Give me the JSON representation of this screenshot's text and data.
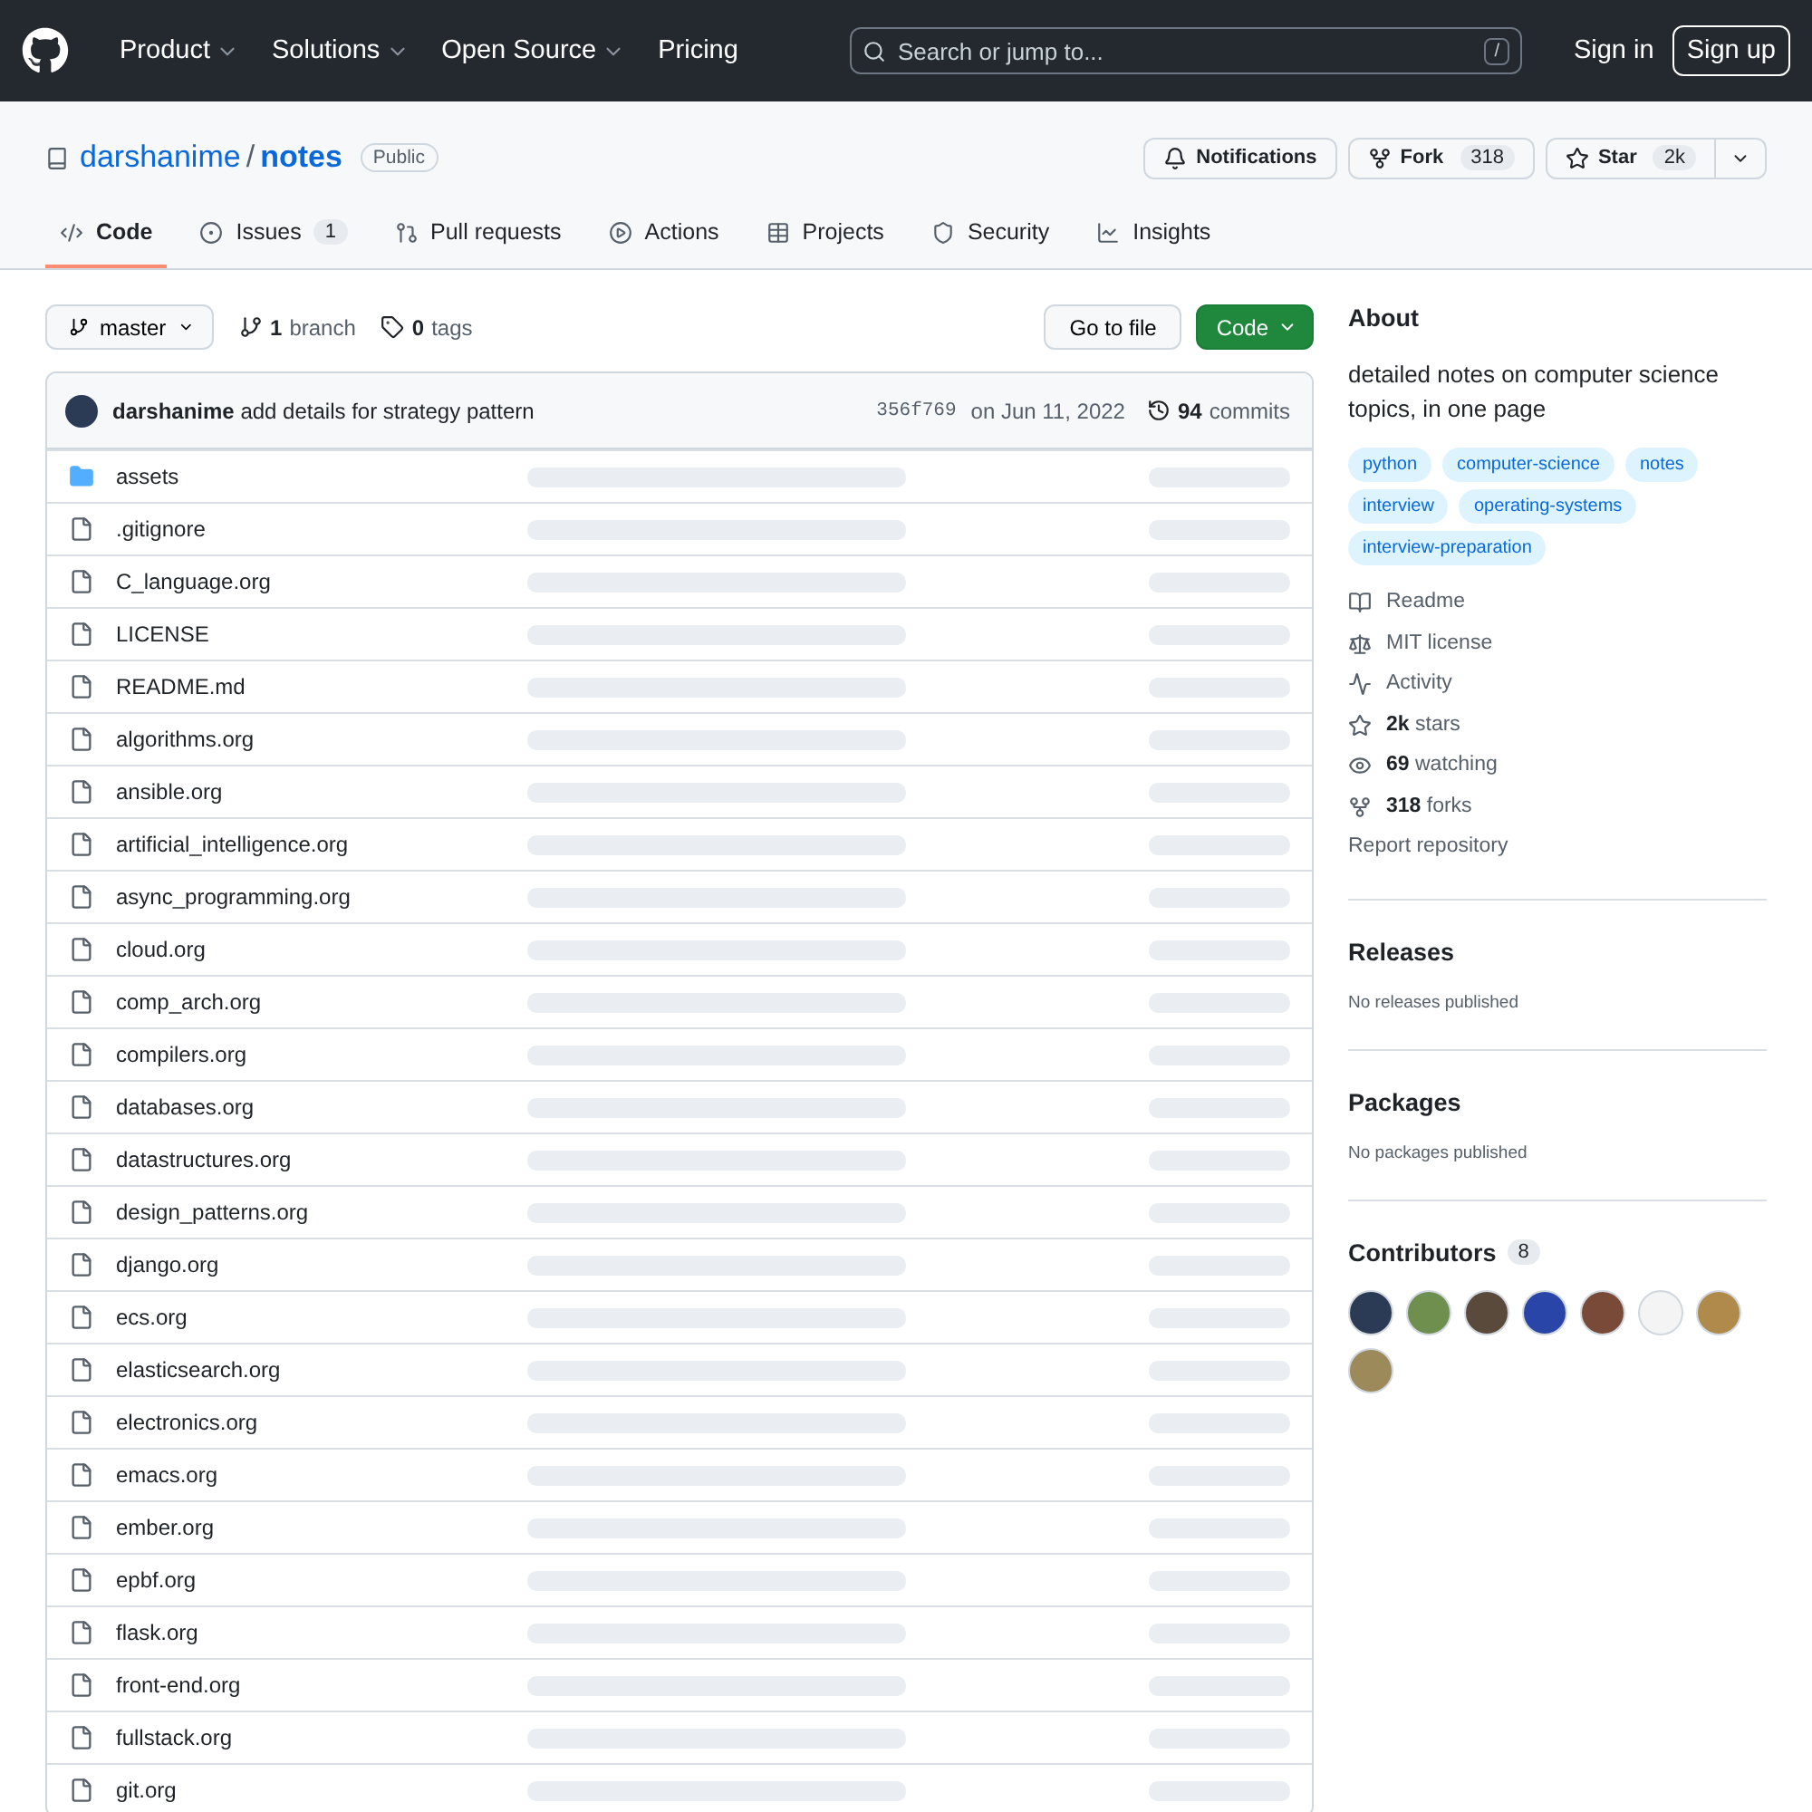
{
  "nav": {
    "items": [
      {
        "label": "Product",
        "dropdown": true
      },
      {
        "label": "Solutions",
        "dropdown": true
      },
      {
        "label": "Open Source",
        "dropdown": true
      },
      {
        "label": "Pricing",
        "dropdown": false
      }
    ],
    "search": {
      "placeholder": "Search or jump to...",
      "shortcut": "/"
    },
    "sign_in": "Sign in",
    "sign_up": "Sign up"
  },
  "repo": {
    "owner": "darshanime",
    "separator": "/",
    "name": "notes",
    "visibility": "Public",
    "actions": [
      {
        "kind": "notifications",
        "label": "Notifications"
      },
      {
        "kind": "fork",
        "label": "Fork",
        "count": "318"
      },
      {
        "kind": "star",
        "label": "Star",
        "count": "2k"
      }
    ]
  },
  "tabs": [
    {
      "kind": "code",
      "label": "Code",
      "selected": true
    },
    {
      "kind": "issues",
      "label": "Issues",
      "count": "1",
      "selected": false
    },
    {
      "kind": "pulls",
      "label": "Pull requests",
      "selected": false
    },
    {
      "kind": "actions",
      "label": "Actions",
      "selected": false
    },
    {
      "kind": "projects",
      "label": "Projects",
      "selected": false
    },
    {
      "kind": "security",
      "label": "Security",
      "selected": false
    },
    {
      "kind": "insights",
      "label": "Insights",
      "selected": false
    }
  ],
  "toolbar": {
    "branch": "master",
    "branches": {
      "count": "1",
      "label": "branch"
    },
    "tags": {
      "count": "0",
      "label": "tags"
    },
    "go_to_file": "Go to file",
    "code": "Code"
  },
  "commit": {
    "author": "darshanime",
    "message": "add details for strategy pattern",
    "sha": "356f769",
    "date": "on Jun 11, 2022",
    "count": "94",
    "label": "commits"
  },
  "files": [
    {
      "kind": "dir",
      "name": "assets"
    },
    {
      "kind": "file",
      "name": ".gitignore"
    },
    {
      "kind": "file",
      "name": "C_language.org"
    },
    {
      "kind": "file",
      "name": "LICENSE"
    },
    {
      "kind": "file",
      "name": "README.md"
    },
    {
      "kind": "file",
      "name": "algorithms.org"
    },
    {
      "kind": "file",
      "name": "ansible.org"
    },
    {
      "kind": "file",
      "name": "artificial_intelligence.org"
    },
    {
      "kind": "file",
      "name": "async_programming.org"
    },
    {
      "kind": "file",
      "name": "cloud.org"
    },
    {
      "kind": "file",
      "name": "comp_arch.org"
    },
    {
      "kind": "file",
      "name": "compilers.org"
    },
    {
      "kind": "file",
      "name": "databases.org"
    },
    {
      "kind": "file",
      "name": "datastructures.org"
    },
    {
      "kind": "file",
      "name": "design_patterns.org"
    },
    {
      "kind": "file",
      "name": "django.org"
    },
    {
      "kind": "file",
      "name": "ecs.org"
    },
    {
      "kind": "file",
      "name": "elasticsearch.org"
    },
    {
      "kind": "file",
      "name": "electronics.org"
    },
    {
      "kind": "file",
      "name": "emacs.org"
    },
    {
      "kind": "file",
      "name": "ember.org"
    },
    {
      "kind": "file",
      "name": "epbf.org"
    },
    {
      "kind": "file",
      "name": "flask.org"
    },
    {
      "kind": "file",
      "name": "front-end.org"
    },
    {
      "kind": "file",
      "name": "fullstack.org"
    },
    {
      "kind": "file",
      "name": "git.org"
    }
  ],
  "about": {
    "title": "About",
    "description": "detailed notes on computer science topics, in one page",
    "topics": [
      "python",
      "computer-science",
      "notes",
      "interview",
      "operating-systems",
      "interview-preparation"
    ],
    "links": [
      {
        "kind": "readme",
        "label": "Readme"
      },
      {
        "kind": "license",
        "label": "MIT license"
      },
      {
        "kind": "activity",
        "label": "Activity"
      },
      {
        "kind": "stars",
        "count": "2k",
        "label": "stars"
      },
      {
        "kind": "watching",
        "count": "69",
        "label": "watching"
      },
      {
        "kind": "forks",
        "count": "318",
        "label": "forks"
      },
      {
        "kind": "report",
        "label": "Report repository"
      }
    ]
  },
  "releases": {
    "title": "Releases",
    "text": "No releases published"
  },
  "packages": {
    "title": "Packages",
    "text": "No packages published"
  },
  "contributors": {
    "title": "Contributors",
    "count": "8",
    "avatars": [
      {
        "color": "#2b3a55"
      },
      {
        "color": "#6f8f4e"
      },
      {
        "color": "#5a4a3c"
      },
      {
        "color": "#2a45a8"
      },
      {
        "color": "#7a4a38"
      },
      {
        "color": "#f4f4f4"
      },
      {
        "color": "#b08a4a"
      },
      {
        "color": "#9c8a5a"
      }
    ]
  }
}
